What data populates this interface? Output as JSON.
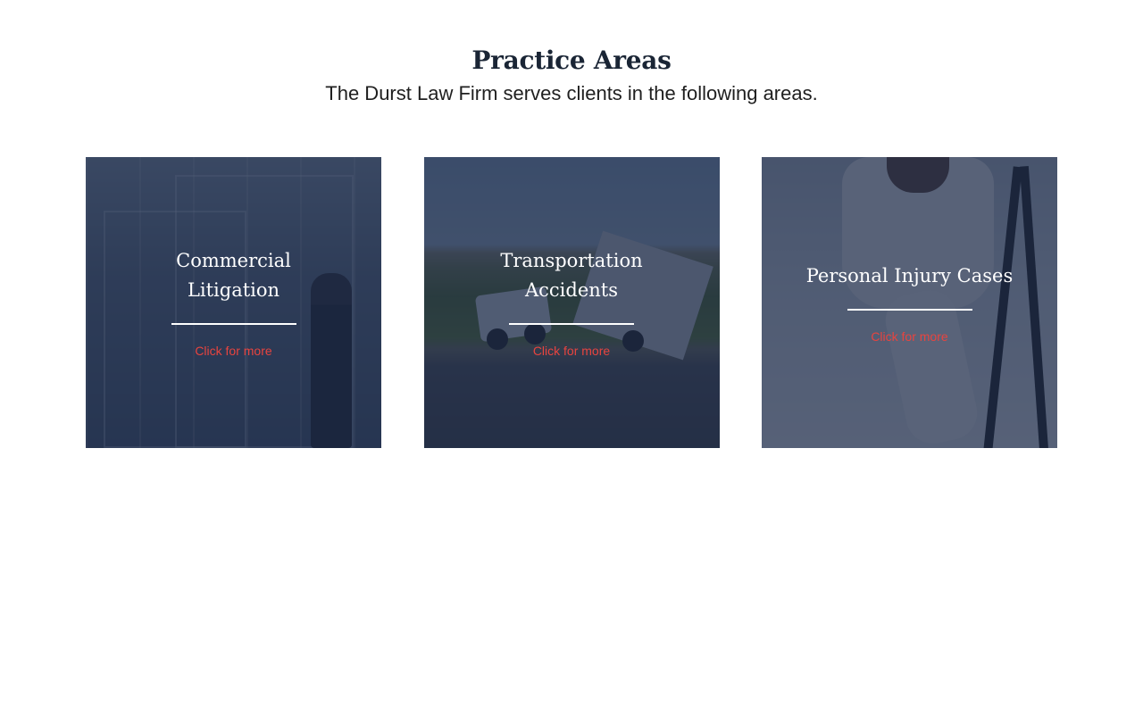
{
  "header": {
    "title": "Practice Areas",
    "subtitle": "The Durst Law Firm serves clients in the following areas."
  },
  "cards": [
    {
      "title": "Commercial Litigation",
      "link": "Click for more",
      "image": "glass office building with woman on phone"
    },
    {
      "title": "Transportation Accidents",
      "link": "Click for more",
      "image": "overturned truck on roadside"
    },
    {
      "title": "Personal Injury Cases",
      "link": "Click for more",
      "image": "man with leg cast and crutches"
    }
  ],
  "colors": {
    "overlay": "#1c2a48",
    "title": "#1a2535",
    "link": "#e8443f",
    "divider": "#ffffff"
  }
}
